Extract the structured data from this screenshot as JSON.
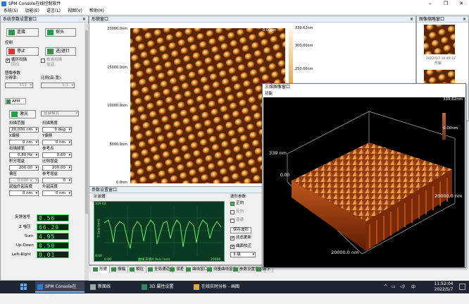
{
  "window": {
    "title": "SPM Console在线控制软件"
  },
  "menu": [
    "系统(S)",
    "功能(E)",
    "语言(L)",
    "视图(V)",
    "帮助(H)"
  ],
  "left_panel": {
    "title": "系统参数设置窗口",
    "connect_label": "连接",
    "disconnect_label": "探头",
    "control_label": "控制",
    "stop_label": "停止",
    "approach_label": "进/退针",
    "loop_scan_label": "循环扫描",
    "return_label": "回扫",
    "calibrate_label": "校准扫描",
    "trace_label": "往返",
    "image_params_label": "图像参数",
    "resolution_label": "分辨率:",
    "resolution_value": "512",
    "ratio_label": "比例(高:宽):",
    "ratio_value": "1:1",
    "afm_tab": "AFM",
    "laser_label": "激光",
    "mode_label": "轻敲模式",
    "scan_range_label": "扫描范围",
    "scan_range_value": "20,000 nm",
    "scan_angle_label": "扫描角度",
    "scan_angle_value": "0 deg",
    "x_offset_label": "X偏移",
    "x_offset_value": "0 nm",
    "y_offset_label": "Y偏移",
    "y_offset_value": "0 nm",
    "scan_freq_label": "扫描频率",
    "scan_freq_value": "0.80 Hz",
    "setpoint_label": "参考点",
    "setpoint_value": "0.60",
    "i_gain_label": "积分增益",
    "i_gain_value": "200.00",
    "p_gain_label": "比例增益",
    "p_gain_value": "200.00",
    "bias_label": "偏压",
    "bias_value": "0.000 V",
    "ref_gain_label": "参考增益",
    "ref_gain_value": "0",
    "z_start_label": "起始升起高度",
    "z_start_value": "0 nm",
    "lift_label": "升起高度",
    "lift_value": "0 nm",
    "signals": [
      {
        "label": "反馈信号",
        "value": "0.56"
      },
      {
        "label": "Z 电压",
        "value": "66.29"
      },
      {
        "label": "Sum",
        "value": "4.95"
      },
      {
        "label": "Up-Down",
        "value": "0.50"
      },
      {
        "label": "Left-Right",
        "value": "0.01"
      }
    ]
  },
  "image_window": {
    "title": "形貌窗口",
    "y_ticks": [
      "20000.0nm",
      "15000.0nm",
      "10000.0nm",
      "5000.0nm",
      "0.0nm"
    ],
    "corner_label": "0.00nm",
    "scale_ticks": [
      "339.62nm",
      "300.00nm",
      "250.00nm"
    ]
  },
  "thumbs_window": {
    "title": "图像缩略窗口",
    "thumb1_date": "2022/5/7 10:49:37",
    "thumb1_name": "形貌"
  },
  "threed_window": {
    "title": "三维图像窗口",
    "menu_label": "功能",
    "scale_top": "339.62nm",
    "scale_bottom": "0.00nm",
    "z_axis_top": "339 nm",
    "z_axis_bottom": "0.00",
    "x_axis_end": "20000.0 nm",
    "y_axis_end": "20000.0 nm"
  },
  "param_window": {
    "title": "参数设置窗口",
    "scope_label": "示波器",
    "osc_ytop": "339.62",
    "osc_ybottom": "0.00",
    "osc_xleft": "0.00",
    "osc_xright": "20000",
    "osc_ylabel": "Y Axis (nm)",
    "osc_xlabel": "曲线  形貌X Axis (nm)",
    "wave_params_label": "波形参数",
    "wave_forward": "正向",
    "wave_backward": "反向",
    "wave_normal": "普通",
    "save_wave": "保存波形",
    "auto_update": "动态更新",
    "tilt_correct": "曲面校正",
    "level_value": "3 级"
  },
  "bottom_tabs": [
    "形貌",
    "振幅",
    "相位",
    "全局通道",
    "误差",
    "曲线窗口",
    "测量曲线窗口",
    "参数设置窗口",
    "数字"
  ],
  "taskbar": {
    "apps": [
      "SPM Console在线...",
      "新面线",
      "3D 属性设置",
      "在线实时分析 - 画图"
    ],
    "time": "11:52:04",
    "date": "2022/5/7",
    "lang": "中"
  }
}
